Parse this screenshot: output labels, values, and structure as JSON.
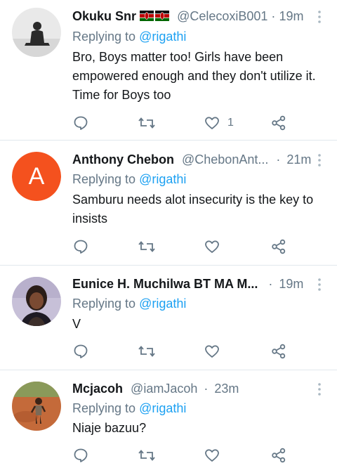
{
  "tweets": [
    {
      "name": "Okuku Snr",
      "flags": "🇰🇪🇰🇪",
      "handle": "@CelecoxiB001",
      "dot": "·",
      "time": "19m",
      "replying_prefix": "Replying to ",
      "replying_to": "@rigathi",
      "text": "Bro, Boys matter too! Girls have been empowered enough and they don't utilize it. Time for Boys too",
      "like_count": "1",
      "avatar": "silhouette-photo"
    },
    {
      "name": "Anthony Chebon",
      "handle": "@ChebonAnt...",
      "dot": "·",
      "time": "21m",
      "replying_prefix": "Replying to ",
      "replying_to": "@rigathi",
      "text": "Samburu needs alot insecurity is the key to insists",
      "like_count": "",
      "avatar_letter": "A",
      "avatar_color": "#f4511e"
    },
    {
      "name": "Eunice H. Muchilwa BT MA M...",
      "handle": "",
      "dot": "·",
      "time": "19m",
      "replying_prefix": "Replying to ",
      "replying_to": "@rigathi",
      "text": "V",
      "like_count": "",
      "avatar": "portrait-photo"
    },
    {
      "name": "Mcjacoh",
      "handle": "@iamJacoh",
      "dot": "·",
      "time": "23m",
      "replying_prefix": "Replying to ",
      "replying_to": "@rigathi",
      "text": "Niaje bazuu?",
      "like_count": "",
      "avatar": "child-on-red-soil-photo"
    }
  ],
  "icons": {
    "reply": "reply-icon",
    "retweet": "retweet-icon",
    "like": "heart-icon",
    "share": "share-icon",
    "more": "more-vertical-icon"
  },
  "colors": {
    "link": "#1da1f2",
    "secondary_text": "#657786",
    "divider": "#e1e8ed",
    "avatar_letter_bg": "#f4511e"
  }
}
